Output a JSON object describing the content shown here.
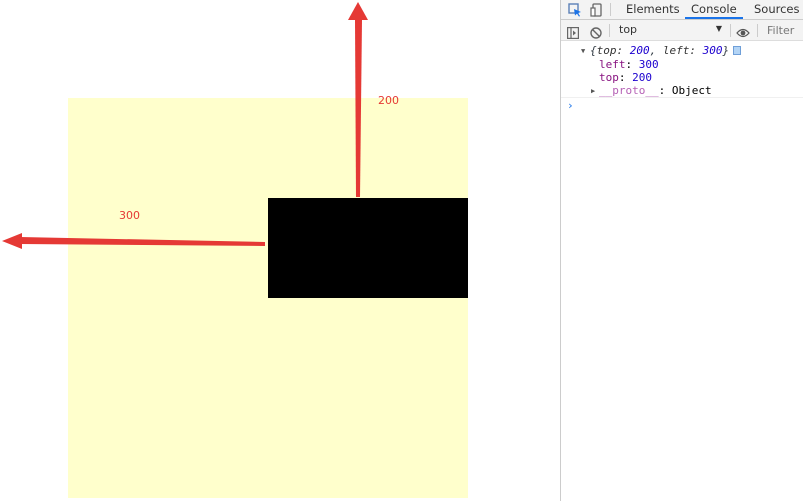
{
  "annotations": {
    "top_value": "200",
    "left_value": "300"
  },
  "colors": {
    "yellow_box": "#ffffcc",
    "black_box": "#000000",
    "arrow": "#e53935",
    "console_tab_underline": "#1a73e8"
  },
  "devtools": {
    "tabs": [
      {
        "label": "Elements"
      },
      {
        "label": "Console",
        "active": true
      },
      {
        "label": "Sources"
      }
    ],
    "toolbar": {
      "context": "top",
      "filter_placeholder": "Filter"
    },
    "console": {
      "summary": {
        "open": "{",
        "top_key": "top: ",
        "top_value": "200",
        "sep": ", ",
        "left_key": "left: ",
        "left_value": "300",
        "close": "}"
      },
      "properties": [
        {
          "name": "left",
          "value": "300"
        },
        {
          "name": "top",
          "value": "200"
        }
      ],
      "proto": {
        "name": "__proto__",
        "value": "Object"
      }
    },
    "icons": [
      "inspect-icon",
      "device-icon",
      "sidebar-toggle-icon",
      "clear-console-icon",
      "eye-icon",
      "info-icon"
    ]
  }
}
